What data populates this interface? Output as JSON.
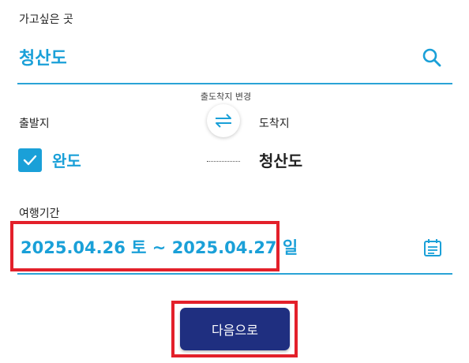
{
  "destination": {
    "label": "가고싶은 곳",
    "value": "청산도",
    "search_icon": "search-icon"
  },
  "route": {
    "swap_caption": "출도착지 변경",
    "swap_icon": "swap-arrows-icon",
    "origin_label": "출발지",
    "destination_label": "도착지",
    "origin_checked": true,
    "origin_name": "완도",
    "destination_name": "청산도"
  },
  "period": {
    "label": "여행기간",
    "value": "2025.04.26 토 ~ 2025.04.27 일",
    "calendar_icon": "calendar-icon"
  },
  "actions": {
    "next_label": "다음으로"
  },
  "colors": {
    "accent": "#1aa0d8",
    "button": "#1f2f80",
    "highlight": "#e3202a"
  }
}
